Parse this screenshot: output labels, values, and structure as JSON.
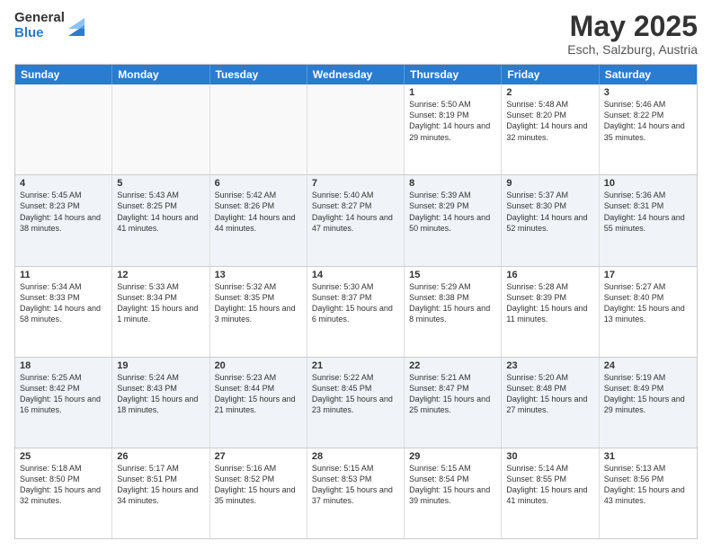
{
  "logo": {
    "general": "General",
    "blue": "Blue"
  },
  "header": {
    "month": "May 2025",
    "location": "Esch, Salzburg, Austria"
  },
  "days": [
    "Sunday",
    "Monday",
    "Tuesday",
    "Wednesday",
    "Thursday",
    "Friday",
    "Saturday"
  ],
  "weeks": [
    [
      {
        "day": "",
        "text": ""
      },
      {
        "day": "",
        "text": ""
      },
      {
        "day": "",
        "text": ""
      },
      {
        "day": "",
        "text": ""
      },
      {
        "day": "1",
        "text": "Sunrise: 5:50 AM\nSunset: 8:19 PM\nDaylight: 14 hours\nand 29 minutes."
      },
      {
        "day": "2",
        "text": "Sunrise: 5:48 AM\nSunset: 8:20 PM\nDaylight: 14 hours\nand 32 minutes."
      },
      {
        "day": "3",
        "text": "Sunrise: 5:46 AM\nSunset: 8:22 PM\nDaylight: 14 hours\nand 35 minutes."
      }
    ],
    [
      {
        "day": "4",
        "text": "Sunrise: 5:45 AM\nSunset: 8:23 PM\nDaylight: 14 hours\nand 38 minutes."
      },
      {
        "day": "5",
        "text": "Sunrise: 5:43 AM\nSunset: 8:25 PM\nDaylight: 14 hours\nand 41 minutes."
      },
      {
        "day": "6",
        "text": "Sunrise: 5:42 AM\nSunset: 8:26 PM\nDaylight: 14 hours\nand 44 minutes."
      },
      {
        "day": "7",
        "text": "Sunrise: 5:40 AM\nSunset: 8:27 PM\nDaylight: 14 hours\nand 47 minutes."
      },
      {
        "day": "8",
        "text": "Sunrise: 5:39 AM\nSunset: 8:29 PM\nDaylight: 14 hours\nand 50 minutes."
      },
      {
        "day": "9",
        "text": "Sunrise: 5:37 AM\nSunset: 8:30 PM\nDaylight: 14 hours\nand 52 minutes."
      },
      {
        "day": "10",
        "text": "Sunrise: 5:36 AM\nSunset: 8:31 PM\nDaylight: 14 hours\nand 55 minutes."
      }
    ],
    [
      {
        "day": "11",
        "text": "Sunrise: 5:34 AM\nSunset: 8:33 PM\nDaylight: 14 hours\nand 58 minutes."
      },
      {
        "day": "12",
        "text": "Sunrise: 5:33 AM\nSunset: 8:34 PM\nDaylight: 15 hours\nand 1 minute."
      },
      {
        "day": "13",
        "text": "Sunrise: 5:32 AM\nSunset: 8:35 PM\nDaylight: 15 hours\nand 3 minutes."
      },
      {
        "day": "14",
        "text": "Sunrise: 5:30 AM\nSunset: 8:37 PM\nDaylight: 15 hours\nand 6 minutes."
      },
      {
        "day": "15",
        "text": "Sunrise: 5:29 AM\nSunset: 8:38 PM\nDaylight: 15 hours\nand 8 minutes."
      },
      {
        "day": "16",
        "text": "Sunrise: 5:28 AM\nSunset: 8:39 PM\nDaylight: 15 hours\nand 11 minutes."
      },
      {
        "day": "17",
        "text": "Sunrise: 5:27 AM\nSunset: 8:40 PM\nDaylight: 15 hours\nand 13 minutes."
      }
    ],
    [
      {
        "day": "18",
        "text": "Sunrise: 5:25 AM\nSunset: 8:42 PM\nDaylight: 15 hours\nand 16 minutes."
      },
      {
        "day": "19",
        "text": "Sunrise: 5:24 AM\nSunset: 8:43 PM\nDaylight: 15 hours\nand 18 minutes."
      },
      {
        "day": "20",
        "text": "Sunrise: 5:23 AM\nSunset: 8:44 PM\nDaylight: 15 hours\nand 21 minutes."
      },
      {
        "day": "21",
        "text": "Sunrise: 5:22 AM\nSunset: 8:45 PM\nDaylight: 15 hours\nand 23 minutes."
      },
      {
        "day": "22",
        "text": "Sunrise: 5:21 AM\nSunset: 8:47 PM\nDaylight: 15 hours\nand 25 minutes."
      },
      {
        "day": "23",
        "text": "Sunrise: 5:20 AM\nSunset: 8:48 PM\nDaylight: 15 hours\nand 27 minutes."
      },
      {
        "day": "24",
        "text": "Sunrise: 5:19 AM\nSunset: 8:49 PM\nDaylight: 15 hours\nand 29 minutes."
      }
    ],
    [
      {
        "day": "25",
        "text": "Sunrise: 5:18 AM\nSunset: 8:50 PM\nDaylight: 15 hours\nand 32 minutes."
      },
      {
        "day": "26",
        "text": "Sunrise: 5:17 AM\nSunset: 8:51 PM\nDaylight: 15 hours\nand 34 minutes."
      },
      {
        "day": "27",
        "text": "Sunrise: 5:16 AM\nSunset: 8:52 PM\nDaylight: 15 hours\nand 35 minutes."
      },
      {
        "day": "28",
        "text": "Sunrise: 5:15 AM\nSunset: 8:53 PM\nDaylight: 15 hours\nand 37 minutes."
      },
      {
        "day": "29",
        "text": "Sunrise: 5:15 AM\nSunset: 8:54 PM\nDaylight: 15 hours\nand 39 minutes."
      },
      {
        "day": "30",
        "text": "Sunrise: 5:14 AM\nSunset: 8:55 PM\nDaylight: 15 hours\nand 41 minutes."
      },
      {
        "day": "31",
        "text": "Sunrise: 5:13 AM\nSunset: 8:56 PM\nDaylight: 15 hours\nand 43 minutes."
      }
    ]
  ]
}
